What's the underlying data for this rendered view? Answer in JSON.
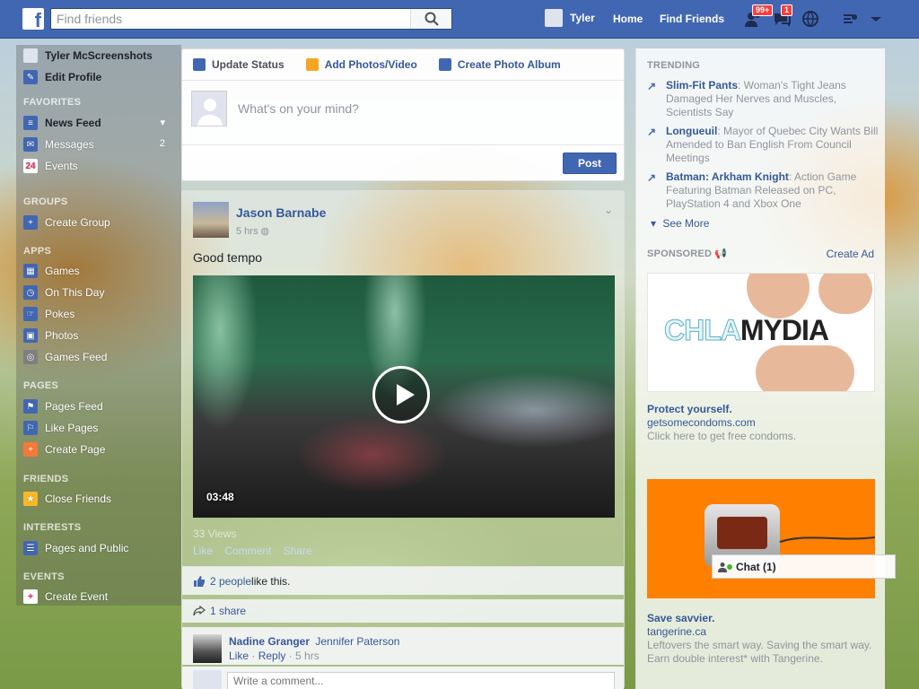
{
  "search": {
    "placeholder": "Find friends"
  },
  "topnav": {
    "user": "Tyler",
    "home": "Home",
    "find_friends": "Find Friends",
    "friend_requests_badge": "99+",
    "messages_badge": "1"
  },
  "left": {
    "profile_name": "Tyler McScreenshots",
    "edit_profile": "Edit Profile",
    "favorites": "FAVORITES",
    "news_feed": "News Feed",
    "messages": "Messages",
    "messages_count": "2",
    "events": "Events",
    "events_icon": "24",
    "groups": "GROUPS",
    "create_group": "Create Group",
    "apps": "APPS",
    "games": "Games",
    "on_this_day": "On This Day",
    "pokes": "Pokes",
    "photos": "Photos",
    "games_feed": "Games Feed",
    "pages": "PAGES",
    "pages_feed": "Pages Feed",
    "like_pages": "Like Pages",
    "create_page": "Create Page",
    "friends": "FRIENDS",
    "close_friends": "Close Friends",
    "interests": "INTERESTS",
    "pages_and_public": "Pages and Public",
    "events_section": "EVENTS",
    "create_event": "Create Event"
  },
  "composer": {
    "update_status": "Update Status",
    "add_photos": "Add Photos/Video",
    "create_album": "Create Photo Album",
    "placeholder": "What's on your mind?",
    "post": "Post"
  },
  "story": {
    "author": "Jason Barnabe",
    "time": "5 hrs",
    "message": "Good tempo",
    "video_duration": "03:48",
    "views": "33 Views",
    "like": "Like",
    "comment": "Comment",
    "share": "Share",
    "likes_text": "2 people",
    "likes_suffix": " like this.",
    "shares": "1 share",
    "comment_author": "Nadine Granger",
    "comment_text": "Jennifer Paterson",
    "comment_like": "Like",
    "comment_reply": "Reply",
    "comment_time": "5 hrs",
    "write_placeholder": "Write a comment..."
  },
  "trending": {
    "heading": "TRENDING",
    "items": [
      {
        "title": "Slim-Fit Pants",
        "text": ": Woman's Tight Jeans Damaged Her Nerves and Muscles, Scientists Say"
      },
      {
        "title": "Longueuil",
        "text": ": Mayor of Quebec City Wants Bill Amended to Ban English From Council Meetings"
      },
      {
        "title": "Batman: Arkham Knight",
        "text": ": Action Game Featuring Batman Released on PC, PlayStation 4 and Xbox One"
      }
    ],
    "see_more": "See More"
  },
  "sponsored": {
    "heading": "SPONSORED",
    "create_ad": "Create Ad",
    "ad1": {
      "image_text_a": "CHLA",
      "image_text_b": "MYDIA",
      "title": "Protect yourself.",
      "domain": "getsomecondoms.com",
      "desc": "Click here to get free condoms."
    },
    "ad2": {
      "title": "Save savvier.",
      "domain": "tangerine.ca",
      "desc": "Leftovers the smart way. Saving the smart way. Earn double interest* with Tangerine."
    }
  },
  "chat": {
    "label": "Chat (1)"
  }
}
